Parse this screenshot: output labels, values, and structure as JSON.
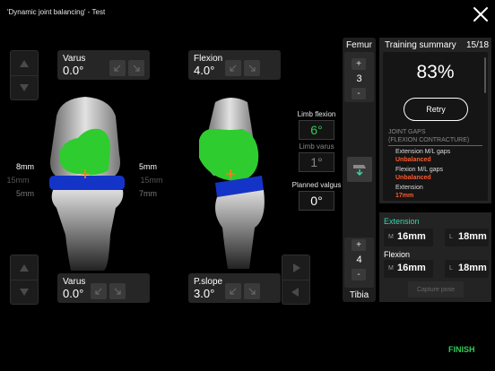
{
  "header": {
    "title": "'Dynamic joint balancing' - Test"
  },
  "colors": {
    "accent_green": "#2ecc57",
    "teal": "#3dd6a8",
    "warning_red": "#ff5a2e",
    "implant_blue": "#1434c8"
  },
  "left_view": {
    "top_angle": {
      "label": "Varus",
      "value": "0.0°"
    },
    "bottom_angle": {
      "label": "Varus",
      "value": "0.0°"
    },
    "gaps_left": [
      "8mm",
      "15mm",
      "5mm"
    ],
    "gaps_right": [
      "5mm",
      "15mm",
      "7mm"
    ]
  },
  "right_view": {
    "top_angle": {
      "label": "Flexion",
      "value": "4.0°"
    },
    "bottom_angle": {
      "label": "P.slope",
      "value": "3.0°"
    }
  },
  "center": {
    "limb_flexion": {
      "label": "Limb flexion",
      "value": "6°"
    },
    "limb_varus": {
      "label": "Limb varus",
      "value": "1°"
    },
    "planned_valgus": {
      "label": "Planned valgus",
      "value": "0°"
    }
  },
  "femur_stepper": {
    "label": "Femur",
    "plus": "+",
    "value": "3",
    "minus": "-"
  },
  "tibia_stepper": {
    "label": "Tibia",
    "plus": "+",
    "value": "4",
    "minus": "-"
  },
  "training_summary": {
    "title": "Training summary",
    "counter": "15/18",
    "percent": "83%",
    "retry_label": "Retry",
    "section_header_1": "JOINT GAPS",
    "section_header_2": "(FLEXION CONTRACTURE)",
    "items": [
      {
        "label": "Extension M/L gaps",
        "status": "Unbalanced"
      },
      {
        "label": "Flexion M/L gaps",
        "status": "Unbalanced"
      },
      {
        "label": "Extension",
        "status": "17mm"
      }
    ]
  },
  "gaps_panel": {
    "extension": {
      "title": "Extension",
      "m_key": "M",
      "m_value": "16mm",
      "l_key": "L",
      "l_value": "18mm"
    },
    "flexion": {
      "title": "Flexion",
      "m_key": "M",
      "m_value": "16mm",
      "l_key": "L",
      "l_value": "18mm"
    },
    "capture_label": "Capture pose"
  },
  "footer": {
    "finish_label": "FINISH"
  }
}
